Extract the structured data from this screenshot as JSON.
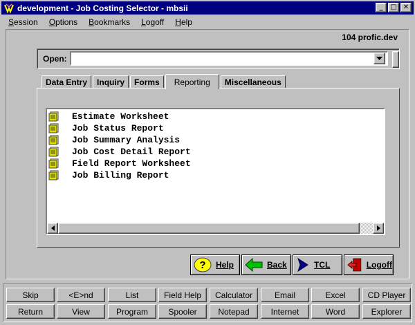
{
  "window": {
    "title": "development - Job Costing Selector - mbsii",
    "min_glyph": "_",
    "max_glyph": "□",
    "close_glyph": "✕"
  },
  "menu": [
    {
      "label": "Session",
      "u": "S",
      "rest": "ession"
    },
    {
      "label": "Options",
      "u": "O",
      "rest": "ptions"
    },
    {
      "label": "Bookmarks",
      "u": "B",
      "rest": "ookmarks"
    },
    {
      "label": "Logoff",
      "u": "L",
      "rest": "ogoff"
    },
    {
      "label": "Help",
      "u": "H",
      "rest": "elp"
    }
  ],
  "server": "104 profic.dev",
  "open": {
    "label": "Open:",
    "value": "",
    "placeholder": ""
  },
  "tabs": [
    {
      "label": "Data Entry",
      "active": false
    },
    {
      "label": "Inquiry",
      "active": false
    },
    {
      "label": "Forms",
      "active": false
    },
    {
      "label": "Reporting",
      "active": true
    },
    {
      "label": "Miscellaneous",
      "active": false
    }
  ],
  "reports": [
    "Estimate Worksheet",
    "Job Status Report",
    "Job Summary Analysis",
    "Job Cost Detail Report",
    "Field Report Worksheet",
    "Job Billing Report"
  ],
  "actions": {
    "help": "Help",
    "back": "Back",
    "tcl": "TCL",
    "logoff": "Logoff"
  },
  "function_keys": {
    "row1": [
      "Skip",
      "<E>nd",
      "List",
      "Field Help",
      "Calculator",
      "Email",
      "Excel",
      "CD Player"
    ],
    "row2": [
      "Return",
      "View",
      "Program",
      "Spooler",
      "Notepad",
      "Internet",
      "Word",
      "Explorer"
    ]
  },
  "colors": {
    "titlebar": "#000080",
    "face": "#c0c0c0",
    "help_icon": "#ffff00",
    "back_icon": "#00c000",
    "tcl_icon": "#000080",
    "logoff_icon": "#c00000"
  }
}
